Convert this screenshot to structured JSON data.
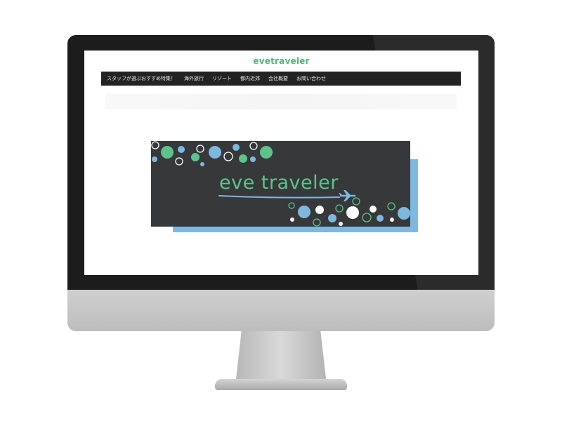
{
  "site": {
    "logo": "evetraveler"
  },
  "nav": {
    "items": [
      "スタッフが選ぶおすすめ特集！",
      "海外旅行",
      "リゾート",
      "都内近郊",
      "会社概要",
      "お問い合わせ"
    ]
  },
  "banner": {
    "title": "eve traveler",
    "plane_icon": "airplane-icon"
  },
  "colors": {
    "brand_green": "#5ec38a",
    "banner_bg": "#37383a",
    "accent_blue": "#7fb8df",
    "nav_bg": "#232323"
  }
}
